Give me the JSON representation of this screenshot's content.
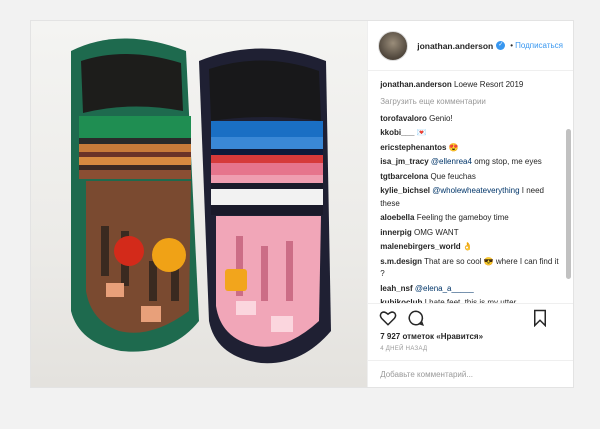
{
  "header": {
    "username": "jonathan.anderson",
    "verified_badge": "✓",
    "separator": "•",
    "follow_label": "Подписаться"
  },
  "caption": {
    "user": "jonathan.anderson",
    "text": "Loewe Resort 2019"
  },
  "load_more": "Загрузить еще комментарии",
  "comments": [
    {
      "user": "torofavaloro",
      "text": "Genio!"
    },
    {
      "user": "kkobi___",
      "text": "💌"
    },
    {
      "user": "ericstephenantos",
      "text": "😍"
    },
    {
      "user": "isa_jm_tracy",
      "mention": "@ellenrea4",
      "text": "omg stop, me eyes"
    },
    {
      "user": "tgtbarcelona",
      "text": "Que feuchas"
    },
    {
      "user": "kylie_bichsel",
      "mention": "@wholewheateverything",
      "text": "I need these"
    },
    {
      "user": "aloebella",
      "text": "Feeling the gameboy time"
    },
    {
      "user": "innerpig",
      "text": "OMG WANT"
    },
    {
      "user": "malenebirgers_world",
      "text": "👌"
    },
    {
      "user": "s.m.design",
      "text": "That are so cool 😎 where I can find it ?"
    },
    {
      "user": "leah_nsf",
      "mention": "@elena_a_____",
      "text": ""
    },
    {
      "user": "kubikoclub",
      "text": "I hate feet, this is my utter"
    }
  ],
  "likes": "7 927 отметок «Нравится»",
  "timestamp": "4 ДНЕЙ НАЗАД",
  "add_comment_placeholder": "Добавьте комментарий...",
  "icons": {
    "like": "heart-icon",
    "comment": "comment-bubble-icon",
    "save": "bookmark-icon"
  },
  "colors": {
    "link_blue": "#3897f0",
    "text": "#262626",
    "muted": "#999999"
  }
}
